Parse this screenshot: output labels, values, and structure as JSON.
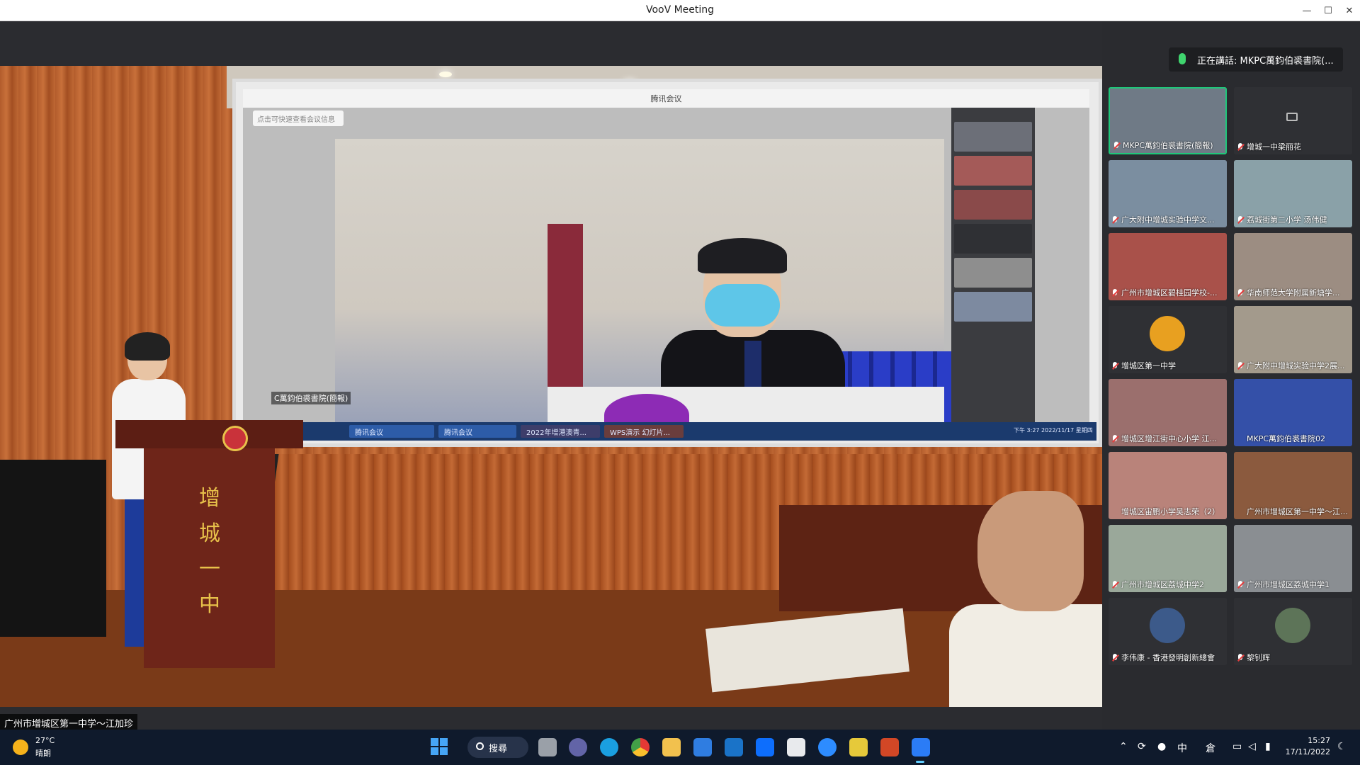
{
  "window": {
    "title": "VooV Meeting",
    "minimize_glyph": "—",
    "maximize_glyph": "☐",
    "close_glyph": "✕"
  },
  "main_video": {
    "speaker_name_tag": "广州市增城区第一中学～江加珍",
    "screen": {
      "title": "腾讯会议",
      "tip": "点击可快速查看会议信息",
      "caption": "C萬鈞伯裘書院(簡報)",
      "taskbar_items": [
        "腾讯会议",
        "腾讯会议",
        "2022年增港澳青...",
        "WPS演示 幻灯片..."
      ],
      "clock": "下午 3:27 2022/11/17 星期四"
    },
    "lectern_text": "增城一中"
  },
  "right_panel": {
    "speaking_label": "正在講話: MKPC萬鈞伯裘書院(...",
    "tiles": [
      {
        "label": "MKPC萬鈞伯裘書院(簡報)",
        "active": true,
        "bg": "#6f7a86",
        "type": "video",
        "mic": "on"
      },
      {
        "label": "增城一中梁丽花",
        "active": false,
        "bg": "#2f3034",
        "type": "camoff",
        "mic": "muted"
      },
      {
        "label": "广大附中增城实验中学文...",
        "active": false,
        "bg": "#7b8ea0",
        "type": "video",
        "mic": "muted"
      },
      {
        "label": "荔城街第二小学 汤伟健",
        "active": false,
        "bg": "#8aa1a8",
        "type": "video",
        "mic": "muted"
      },
      {
        "label": "广州市增城区碧桂园学校-...",
        "active": false,
        "bg": "#a9514a",
        "type": "video",
        "mic": "muted"
      },
      {
        "label": "华南师范大学附属新塘学...",
        "active": false,
        "bg": "#9c8d82",
        "type": "video",
        "mic": "muted"
      },
      {
        "label": "增城区第一中学",
        "active": false,
        "bg": "#2f3034",
        "type": "avatar",
        "avatar_color": "#e8a020",
        "mic": "on"
      },
      {
        "label": "广大附中增城实验中学2展...",
        "active": false,
        "bg": "#a39a8c",
        "type": "video",
        "mic": "muted"
      },
      {
        "label": "增城区增江街中心小学 江...",
        "active": false,
        "bg": "#9b6f6d",
        "type": "video",
        "mic": "muted"
      },
      {
        "label": "MKPC萬鈞伯裘書院02",
        "active": false,
        "bg": "#3450a8",
        "type": "video",
        "mic": "none"
      },
      {
        "label": "增城区宙鹏小学吴志荣（2）",
        "active": false,
        "bg": "#b9837a",
        "type": "video",
        "mic": "none"
      },
      {
        "label": "广州市增城区第一中学～江加珍",
        "active": false,
        "bg": "#8b5a3e",
        "type": "video",
        "mic": "none"
      },
      {
        "label": "广州市增城区荔城中学2",
        "active": false,
        "bg": "#9aa89a",
        "type": "video",
        "mic": "muted"
      },
      {
        "label": "广州市增城区荔城中学1",
        "active": false,
        "bg": "#8a8e92",
        "type": "video",
        "mic": "muted"
      },
      {
        "label": "李伟康 - 香港發明創新總會",
        "active": false,
        "bg": "#2f3034",
        "type": "avatar",
        "avatar_color": "#3c5a8a",
        "mic": "muted"
      },
      {
        "label": "黎钊辉",
        "active": false,
        "bg": "#2f3034",
        "type": "avatar",
        "avatar_color": "#5d7458",
        "mic": "muted"
      }
    ]
  },
  "taskbar": {
    "weather_temp": "27°C",
    "weather_cond": "晴朗",
    "search_label": "搜尋",
    "tray": {
      "ime": "中",
      "ime2": "倉"
    },
    "clock_time": "15:27",
    "clock_date": "17/11/2022"
  }
}
